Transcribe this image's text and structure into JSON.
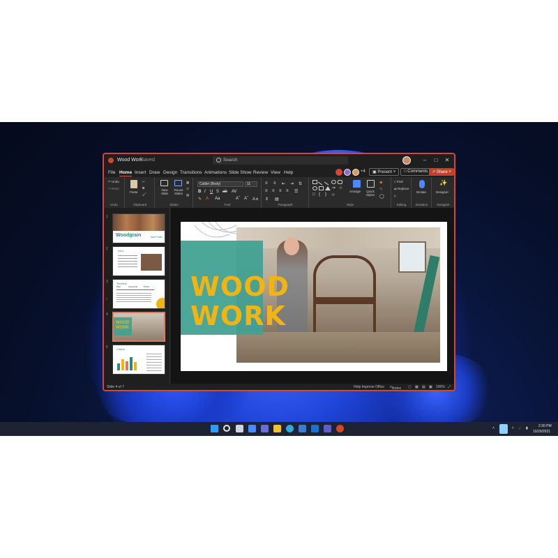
{
  "window": {
    "doc_title": "Wood Work",
    "saved_status": "Saved",
    "search_placeholder": "Search"
  },
  "menu": {
    "items": [
      "File",
      "Home",
      "Insert",
      "Draw",
      "Design",
      "Transitions",
      "Animations",
      "Slide Show",
      "Review",
      "View",
      "Help"
    ],
    "active": "Home",
    "collaborators_extra": "+4",
    "present_label": "Present",
    "comments_label": "Comments",
    "share_label": "Share"
  },
  "ribbon": {
    "undo_label": "Undo",
    "redo_label": "Redo",
    "paste_label": "Paste",
    "new_slide_label": "New Slide",
    "reuse_slides_label": "Reuse Slides",
    "font_name": "Calibri (Body)",
    "font_size": "11",
    "arrange_label": "Arrange",
    "quick_styles_label": "Quick Styles",
    "find_label": "Find",
    "replace_label": "Replace",
    "dictate_label": "Dictate",
    "designer_label": "Designer",
    "groups": [
      "Undo",
      "Clipboard",
      "Slides",
      "Font",
      "Paragraph",
      "Style",
      "Editing",
      "Dictation",
      "Designer"
    ]
  },
  "thumbnails": [
    {
      "num": "1",
      "title": "Woodgrain",
      "subtitle": "Jane Potter"
    },
    {
      "num": "2",
      "title": "Intro"
    },
    {
      "num": "3",
      "title": "Timeline",
      "labels": [
        "Plan",
        "Assemble",
        "Finish"
      ]
    },
    {
      "num": "4",
      "title": "WOOD WORK"
    },
    {
      "num": "5",
      "title": "Charts"
    }
  ],
  "slide": {
    "line1": "WOOD",
    "line2": "WORK"
  },
  "status": {
    "slide_position": "Slide 4 of 7",
    "help_improve": "Help Improve Office",
    "notes_label": "Notes",
    "zoom": "100%"
  },
  "system": {
    "time": "2:30 PM",
    "date": "10/20/2021"
  },
  "colors": {
    "accent_window_border": "#d6453a",
    "slide_title": "#f2b413",
    "slide_teal": "#40a091"
  }
}
